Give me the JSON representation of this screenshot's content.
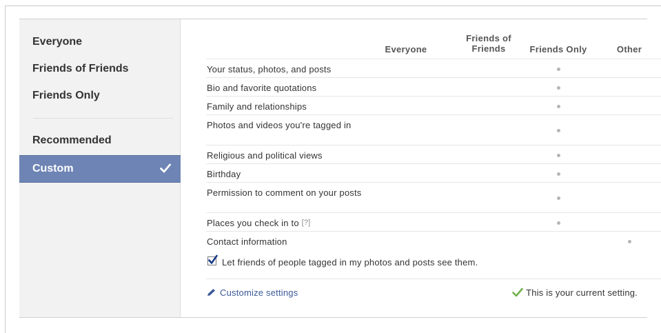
{
  "sidebar": {
    "items": [
      {
        "label": "Everyone"
      },
      {
        "label": "Friends of Friends"
      },
      {
        "label": "Friends Only"
      },
      {
        "label": "Recommended"
      },
      {
        "label": "Custom",
        "selected": true,
        "icon": "checkmark-icon"
      }
    ]
  },
  "table": {
    "columns": [
      "Everyone",
      "Friends of Friends",
      "Friends Only",
      "Other"
    ],
    "rows": [
      {
        "label": "Your status, photos, and posts",
        "setting": "Friends Only"
      },
      {
        "label": "Bio and favorite quotations",
        "setting": "Friends Only"
      },
      {
        "label": "Family and relationships",
        "setting": "Friends Only"
      },
      {
        "label": "Photos and videos you're tagged in",
        "setting": "Friends Only"
      },
      {
        "label": "Religious and political views",
        "setting": "Friends Only"
      },
      {
        "label": "Birthday",
        "setting": "Friends Only"
      },
      {
        "label": "Permission to comment on your posts",
        "setting": "Friends Only"
      },
      {
        "label": "Places you check in to",
        "help": "[?]",
        "setting": "Friends Only"
      },
      {
        "label": "Contact information",
        "setting": "Other"
      }
    ]
  },
  "tagged_option": {
    "label": "Let friends of people tagged in my photos and posts see them.",
    "checked": true
  },
  "footer": {
    "customize_label": "Customize settings",
    "customize_icon": "pencil-icon",
    "current_label": "This is your current setting.",
    "current_icon": "green-check-icon"
  },
  "colors": {
    "selected_bg": "#6d84b4",
    "link": "#3b5998",
    "dot": "#b5b5b5",
    "check_green": "#6fb24a"
  }
}
